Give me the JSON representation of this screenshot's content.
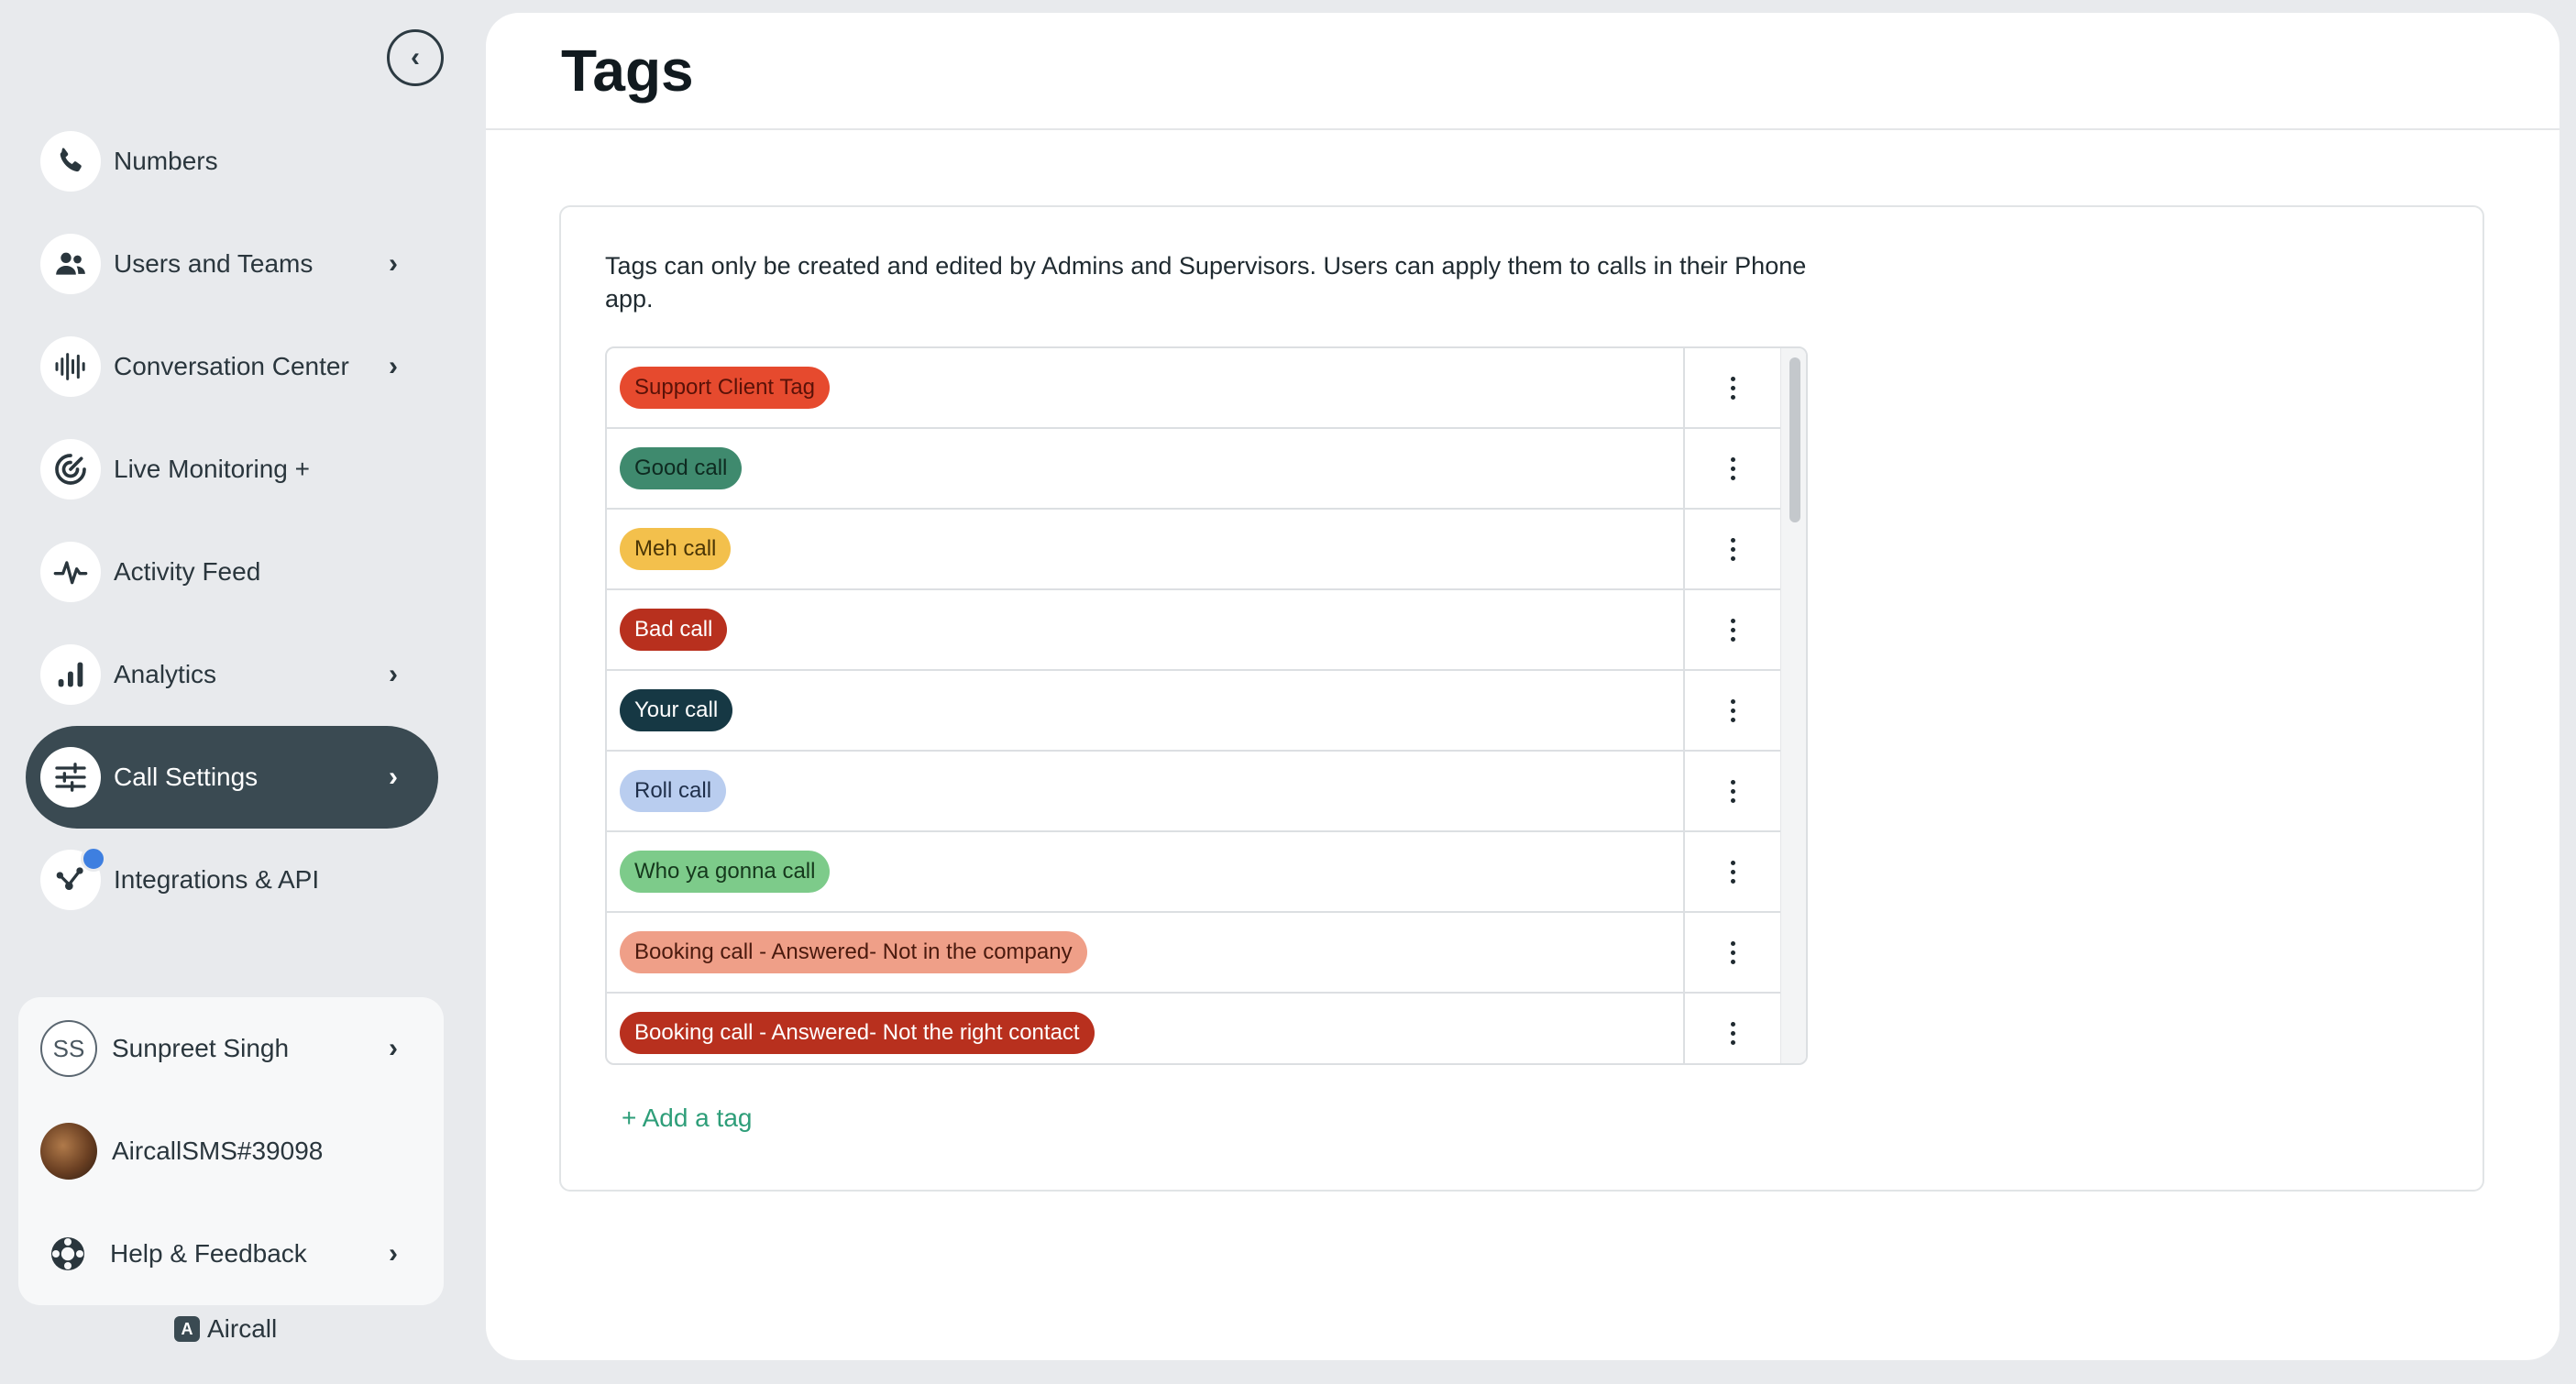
{
  "sidebar": {
    "items": [
      {
        "label": "Numbers",
        "icon": "phone-icon",
        "chevron": false
      },
      {
        "label": "Users and Teams",
        "icon": "users-icon",
        "chevron": true
      },
      {
        "label": "Conversation Center",
        "icon": "waveform-icon",
        "chevron": true
      },
      {
        "label": "Live Monitoring +",
        "icon": "monitoring-icon",
        "chevron": false
      },
      {
        "label": "Activity Feed",
        "icon": "pulse-icon",
        "chevron": false
      },
      {
        "label": "Analytics",
        "icon": "bar-chart-icon",
        "chevron": true
      },
      {
        "label": "Call Settings",
        "icon": "sliders-icon",
        "chevron": true,
        "active": true
      },
      {
        "label": "Integrations & API",
        "icon": "integrations-icon",
        "chevron": false
      }
    ],
    "chevron_glyph": "›",
    "collapse_glyph": "‹"
  },
  "account": {
    "user_initials": "SS",
    "user_name": "Sunpreet Singh",
    "company": "AircallSMS#39098",
    "help": "Help & Feedback"
  },
  "brand": {
    "logo_letter": "A",
    "name": "Aircall"
  },
  "page": {
    "title": "Tags",
    "description": "Tags can only be created and edited by Admins and Supervisors. Users can apply them to calls in their Phone app.",
    "add_tag": "+ Add a tag"
  },
  "tags": [
    {
      "name": "Support Client Tag",
      "bg": "#e64a2e",
      "fg": "#5a1208"
    },
    {
      "name": "Good call",
      "bg": "#3f8a6e",
      "fg": "#0e2a20"
    },
    {
      "name": "Meh call",
      "bg": "#f3c04c",
      "fg": "#4a3506"
    },
    {
      "name": "Bad call",
      "bg": "#b8301e",
      "fg": "#ffffff"
    },
    {
      "name": "Your call",
      "bg": "#163844",
      "fg": "#ffffff"
    },
    {
      "name": "Roll call",
      "bg": "#b9cdef",
      "fg": "#1f2f4a"
    },
    {
      "name": "Who ya gonna call",
      "bg": "#7dcb8a",
      "fg": "#15381c"
    },
    {
      "name": "Booking call - Answered- Not in the company",
      "bg": "#ef9f88",
      "fg": "#4a1a0e"
    },
    {
      "name": "Booking call - Answered- Not the right contact",
      "bg": "#b8301e",
      "fg": "#ffffff"
    }
  ],
  "colors": {
    "accent": "#2e9e79",
    "active_nav": "#3a4a52",
    "notification": "#3e7fe0"
  }
}
